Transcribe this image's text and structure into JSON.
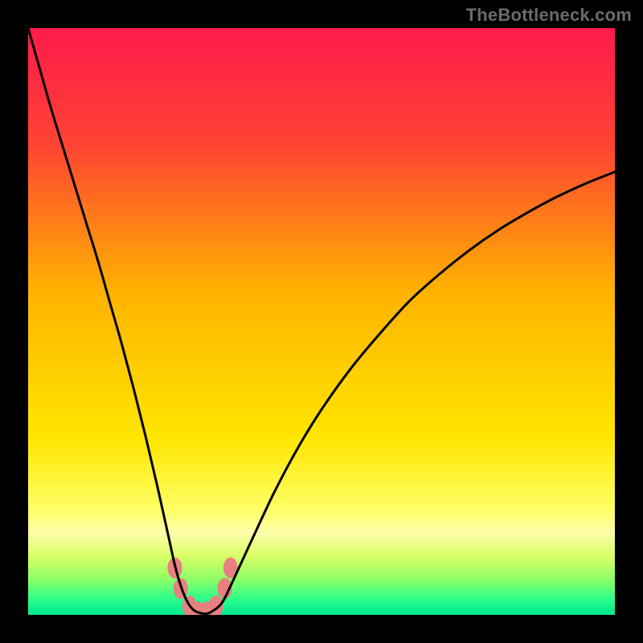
{
  "watermark": "TheBottleneck.com",
  "chart_data": {
    "type": "line",
    "title": "",
    "xlabel": "",
    "ylabel": "",
    "xlim": [
      0,
      100
    ],
    "ylim": [
      0,
      100
    ],
    "background_gradient": {
      "stops": [
        {
          "offset": 0.0,
          "color": "#ff1a4b"
        },
        {
          "offset": 0.2,
          "color": "#ff4433"
        },
        {
          "offset": 0.45,
          "color": "#ffb300"
        },
        {
          "offset": 0.7,
          "color": "#ffe600"
        },
        {
          "offset": 0.82,
          "color": "#ffff66"
        },
        {
          "offset": 0.86,
          "color": "#ffffaa"
        },
        {
          "offset": 0.9,
          "color": "#d9ff66"
        },
        {
          "offset": 0.94,
          "color": "#8cff66"
        },
        {
          "offset": 0.97,
          "color": "#33ff88"
        },
        {
          "offset": 1.0,
          "color": "#00e890"
        }
      ]
    },
    "series": [
      {
        "name": "bottleneck-curve",
        "color": "#000000",
        "x": [
          0,
          2,
          4,
          6,
          8,
          10,
          12,
          14,
          16,
          18,
          20,
          22,
          24,
          25,
          26,
          27,
          28,
          29,
          30,
          31,
          33,
          35,
          38,
          42,
          46,
          50,
          55,
          60,
          65,
          70,
          75,
          80,
          85,
          90,
          95,
          100
        ],
        "values": [
          100,
          93,
          86,
          79.5,
          73,
          66.5,
          60,
          53,
          46,
          38.5,
          30.5,
          22,
          13,
          8.5,
          5,
          2.5,
          1,
          0.4,
          0.2,
          0.4,
          2,
          6,
          12.5,
          21,
          28.5,
          35,
          42,
          48,
          53.5,
          58,
          62,
          65.5,
          68.5,
          71.2,
          73.5,
          75.5
        ]
      }
    ],
    "markers": {
      "color": "#e98080",
      "points": [
        {
          "x": 25.0,
          "y": 8.0
        },
        {
          "x": 26.0,
          "y": 4.5
        },
        {
          "x": 27.5,
          "y": 1.5
        },
        {
          "x": 29.0,
          "y": 0.5
        },
        {
          "x": 30.5,
          "y": 0.5
        },
        {
          "x": 32.0,
          "y": 1.5
        },
        {
          "x": 33.5,
          "y": 4.5
        },
        {
          "x": 34.5,
          "y": 8.0
        }
      ]
    }
  }
}
